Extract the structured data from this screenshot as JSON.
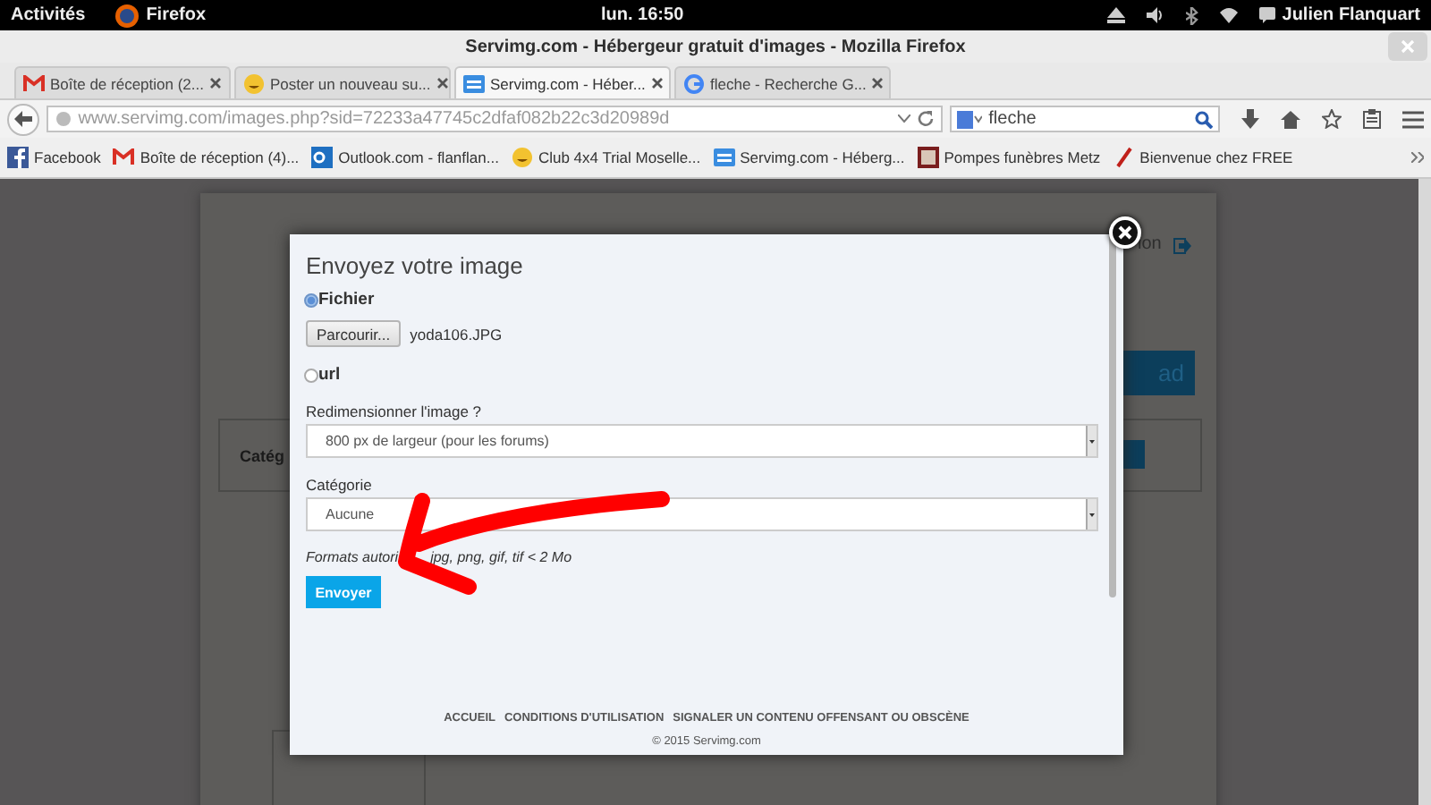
{
  "system_bar": {
    "activities": "Activités",
    "app": "Firefox",
    "clock": "lun. 16:50",
    "user": "Julien Flanquart"
  },
  "window": {
    "title": "Servimg.com - Hébergeur gratuit d'images - Mozilla Firefox"
  },
  "tabs": [
    {
      "label": "Boîte de réception (2...",
      "selected": false,
      "kind": "mail"
    },
    {
      "label": "Poster un nouveau su...",
      "selected": false,
      "kind": "smiley"
    },
    {
      "label": "Servimg.com - Héber...",
      "selected": true,
      "kind": "lines"
    },
    {
      "label": "fleche - Recherche G...",
      "selected": false,
      "kind": "google"
    }
  ],
  "address": {
    "url": "www.servimg.com/images.php?sid=72233a47745c2dfaf082b22c3d20989d"
  },
  "search": {
    "value": "fleche"
  },
  "bookmarks": [
    {
      "label": "Facebook",
      "kind": "facebook"
    },
    {
      "label": "Boîte de réception (4)...",
      "kind": "mail"
    },
    {
      "label": "Outlook.com - flanflan...",
      "kind": "outlook"
    },
    {
      "label": "Club 4x4 Trial Moselle...",
      "kind": "smiley"
    },
    {
      "label": "Servimg.com - Héberg...",
      "kind": "lines"
    },
    {
      "label": "Pompes funèbres Metz",
      "kind": "photo"
    },
    {
      "label": "Bienvenue chez FREE",
      "kind": "free"
    }
  ],
  "background_page": {
    "logout_text": "ion",
    "upload_button": "ad",
    "category_label": "Catég"
  },
  "modal": {
    "title": "Envoyez votre image",
    "sources": [
      {
        "label": "Fichier",
        "selected": true
      },
      {
        "label": "url",
        "selected": false
      }
    ],
    "browse_button": "Parcourir...",
    "file_name": "yoda106.JPG",
    "resize_label": "Redimensionner l'image ?",
    "resize_value": "800 px de largeur (pour les forums)",
    "category_label": "Catégorie",
    "category_value": "Aucune",
    "formats_parts": [
      "Formats autori",
      "jpg, png, gif, tif < 2 Mo"
    ],
    "submit": "Envoyer",
    "footer_links": [
      "ACCUEIL",
      "CONDITIONS D'UTILISATION",
      "SIGNALER UN CONTENU OFFENSANT OU OBSCÈNE"
    ],
    "copyright": "© 2015 Servimg.com"
  }
}
